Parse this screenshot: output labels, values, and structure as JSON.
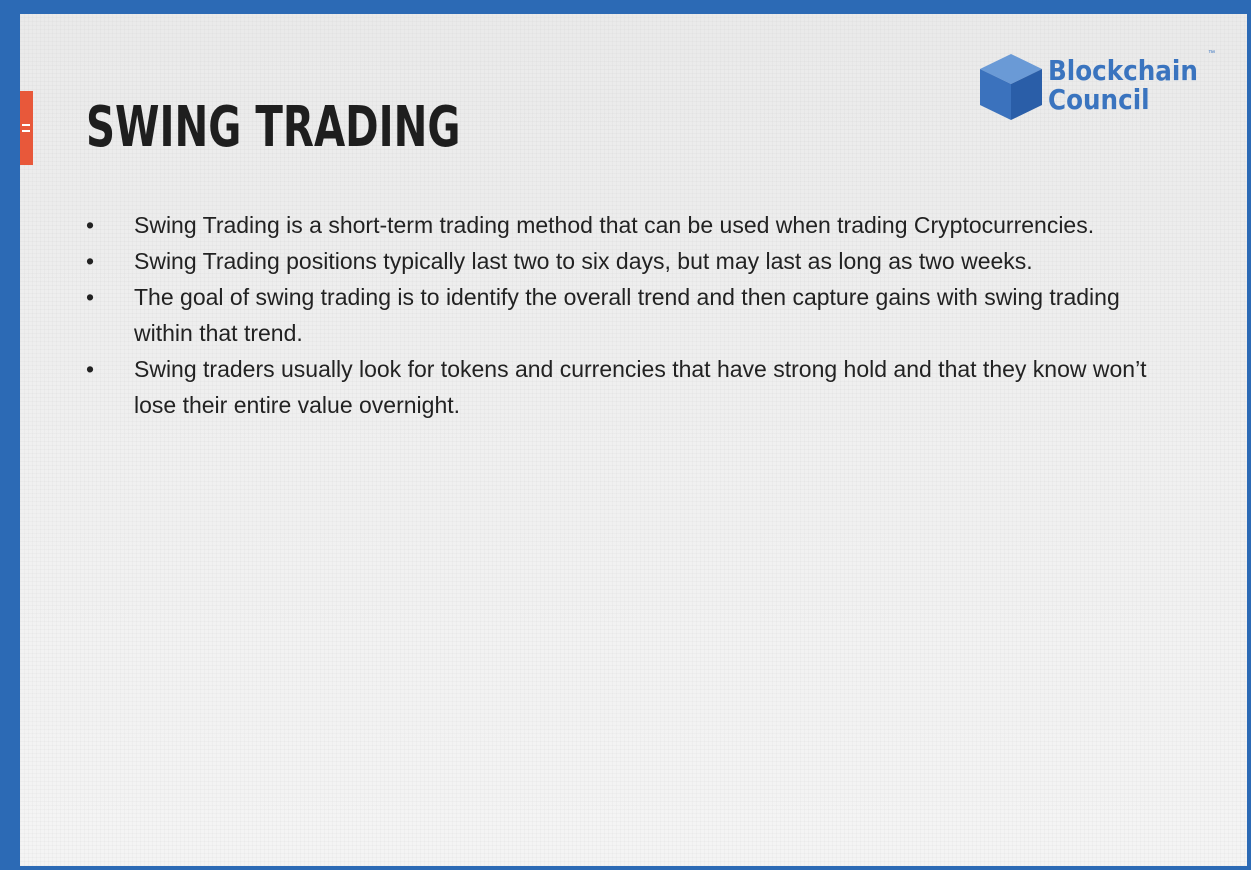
{
  "slide": {
    "title": "SWING TRADING",
    "logo": {
      "line1": "Blockchain",
      "line2": "Council",
      "trademark": "™",
      "color": "#3a74bf"
    },
    "bullet_symbol": "•",
    "bullets": [
      "Swing Trading is a short-term trading method that can be used when trading Cryptocurrencies.",
      "Swing Trading positions typically last two to six days, but may last as long as two weeks.",
      "The goal of swing trading is to identify the overall trend and then capture gains with swing trading within that trend.",
      "Swing traders usually look for tokens and currencies that have strong hold and that they know won’t lose their entire value overnight."
    ],
    "colors": {
      "frame": "#2c6ab5",
      "accent": "#e8583a",
      "title": "#1e1e1e",
      "body_text": "#222222"
    }
  }
}
